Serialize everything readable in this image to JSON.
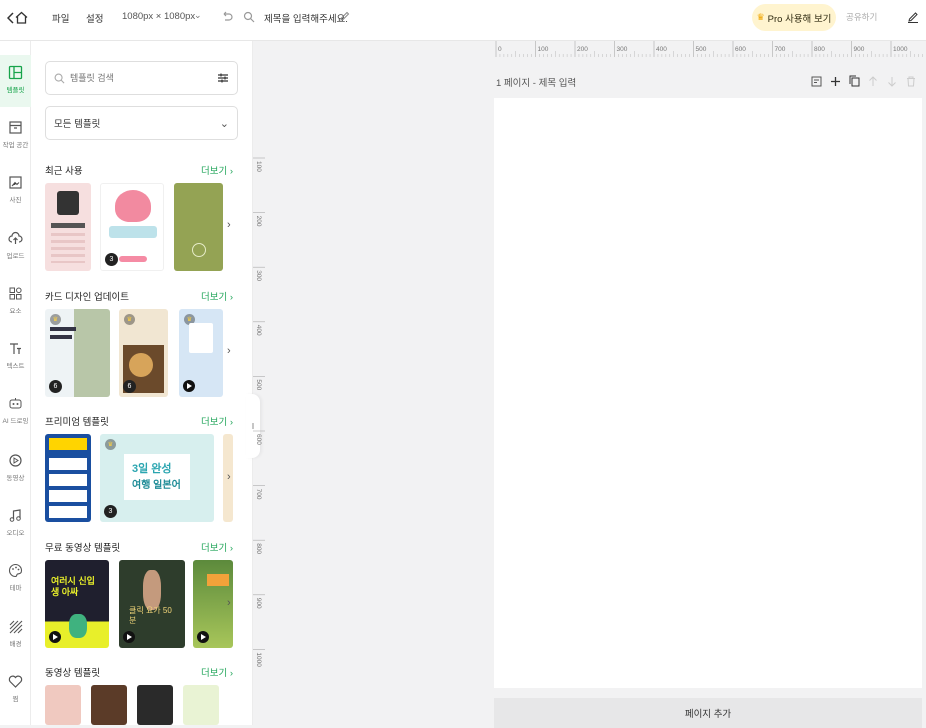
{
  "topbar": {
    "back_icon": "chevron-left-icon",
    "home_icon": "home-icon",
    "menu_file": "파일",
    "menu_settings": "설정",
    "size": "1080px × 1080px",
    "title_placeholder": "제목을 입력해주세요.",
    "pro_label": "Pro 사용해 보기",
    "share_label": "공유하기",
    "pro_icon": "crown-icon"
  },
  "leftnav": {
    "items": [
      {
        "label": "템플릿",
        "icon": "template-icon",
        "active": true
      },
      {
        "label": "작업 공간",
        "icon": "archive-icon"
      },
      {
        "label": "사진",
        "icon": "photo-icon"
      },
      {
        "label": "업로드",
        "icon": "cloud-upload-icon"
      },
      {
        "label": "요소",
        "icon": "shapes-icon"
      },
      {
        "label": "텍스트",
        "icon": "text-icon"
      },
      {
        "label": "AI 드로잉",
        "icon": "robot-icon"
      },
      {
        "label": "동영상",
        "icon": "play-circle-icon"
      },
      {
        "label": "오디오",
        "icon": "music-icon"
      },
      {
        "label": "테마",
        "icon": "palette-icon"
      },
      {
        "label": "배경",
        "icon": "pattern-icon"
      },
      {
        "label": "찜",
        "icon": "heart-icon"
      }
    ]
  },
  "panel": {
    "search_placeholder": "템플릿 검색",
    "filter_value": "모든 템플릿",
    "sections": [
      {
        "title": "최근 사용",
        "more": "더보기"
      },
      {
        "title": "카드 디자인 업데이트",
        "more": "더보기"
      },
      {
        "title": "프리미엄 템플릿",
        "more": "더보기"
      },
      {
        "title": "무료 동영상 템플릿",
        "more": "더보기"
      },
      {
        "title": "동영상 템플릿",
        "more": "더보기"
      }
    ],
    "badges": {
      "recent_2": "3",
      "card_1": "6",
      "card_2": "6",
      "premium_2": "3"
    },
    "thumb_texts": {
      "premium_2_line1": "3일 완성",
      "premium_2_line2": "여행 일본어",
      "video_1": "여러시 신입생 아싸",
      "video_2": "클릭 요가 50분"
    }
  },
  "canvas": {
    "page_label": "1 페이지 - 제목 입력",
    "add_page": "페이지 추가",
    "ruler_top": [
      "0",
      "100",
      "200",
      "300",
      "400",
      "500",
      "600",
      "700",
      "800",
      "900",
      "1000"
    ],
    "ruler_left": [
      "100",
      "200",
      "300",
      "400",
      "500",
      "600",
      "700",
      "800",
      "900",
      "1000"
    ]
  },
  "colors": {
    "accent_green": "#22a55a",
    "pro_bg": "#fff4cf"
  }
}
